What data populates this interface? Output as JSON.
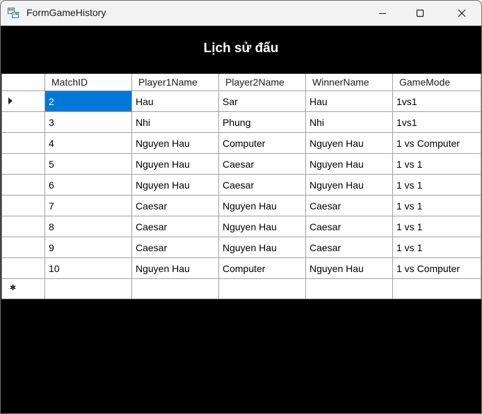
{
  "window": {
    "title": "FormGameHistory"
  },
  "heading": "Lịch sử đấu",
  "grid": {
    "columns": [
      "MatchID",
      "Player1Name",
      "Player2Name",
      "WinnerName",
      "GameMode"
    ],
    "rows": [
      [
        "2",
        "Hau",
        "Sar",
        "Hau",
        "1vs1"
      ],
      [
        "3",
        "Nhi",
        "Phung",
        "Nhi",
        "1vs1"
      ],
      [
        "4",
        "Nguyen Hau",
        "Computer",
        "Nguyen Hau",
        "1 vs Computer"
      ],
      [
        "5",
        "Nguyen Hau",
        "Caesar",
        "Nguyen Hau",
        "1 vs 1"
      ],
      [
        "6",
        "Nguyen Hau",
        "Caesar",
        "Nguyen Hau",
        "1 vs 1"
      ],
      [
        "7",
        "Caesar",
        "Nguyen Hau",
        "Caesar",
        "1 vs 1"
      ],
      [
        "8",
        "Caesar",
        "Nguyen Hau",
        "Caesar",
        "1 vs 1"
      ],
      [
        "9",
        "Caesar",
        "Nguyen Hau",
        "Caesar",
        "1 vs 1"
      ],
      [
        "10",
        "Nguyen Hau",
        "Computer",
        "Nguyen Hau",
        "1 vs Computer"
      ]
    ],
    "current_row_indicator": "triangle-right-icon",
    "new_row_indicator": "asterisk-icon",
    "selection_color": "#0078d7"
  }
}
